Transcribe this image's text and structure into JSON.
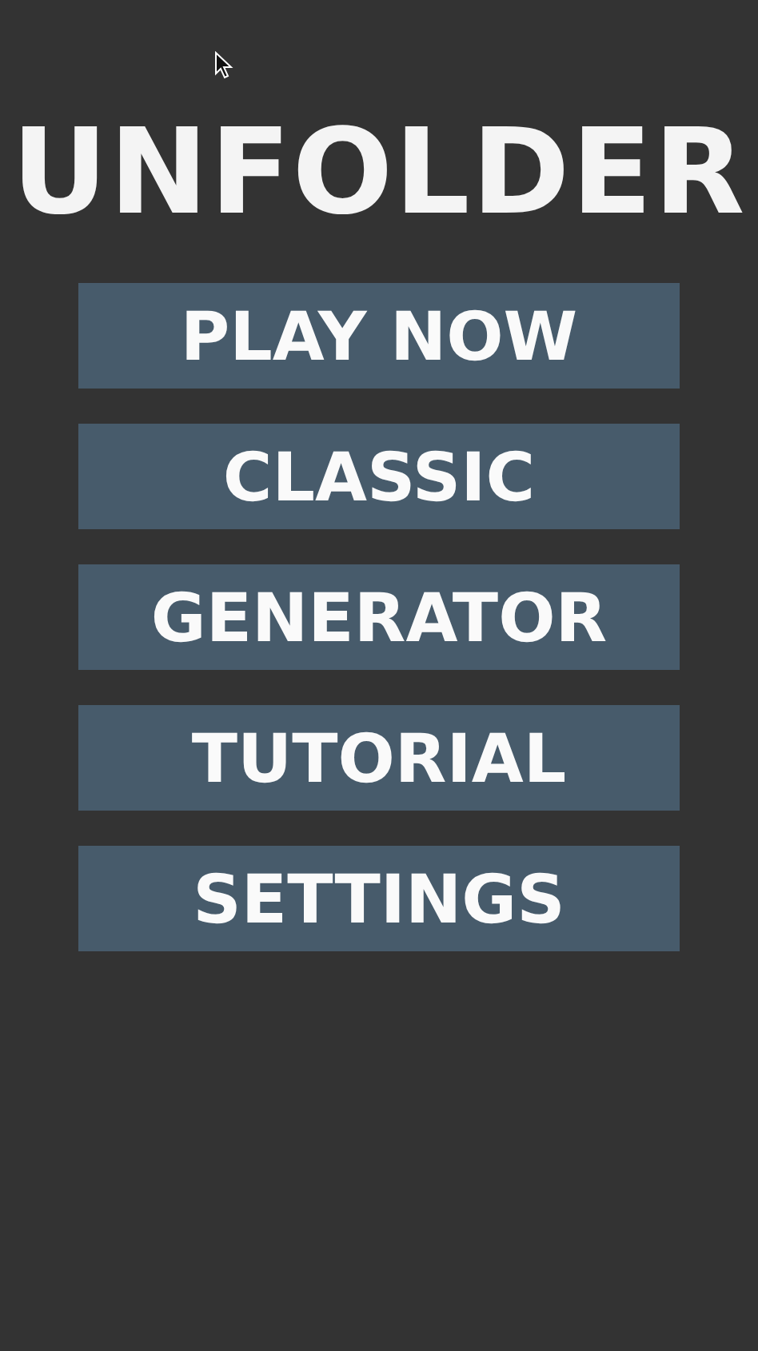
{
  "title": "UNFOLDER",
  "menu": [
    {
      "label": "PLAY NOW"
    },
    {
      "label": "CLASSIC"
    },
    {
      "label": "GENERATOR"
    },
    {
      "label": "TUTORIAL"
    },
    {
      "label": "SETTINGS"
    }
  ]
}
